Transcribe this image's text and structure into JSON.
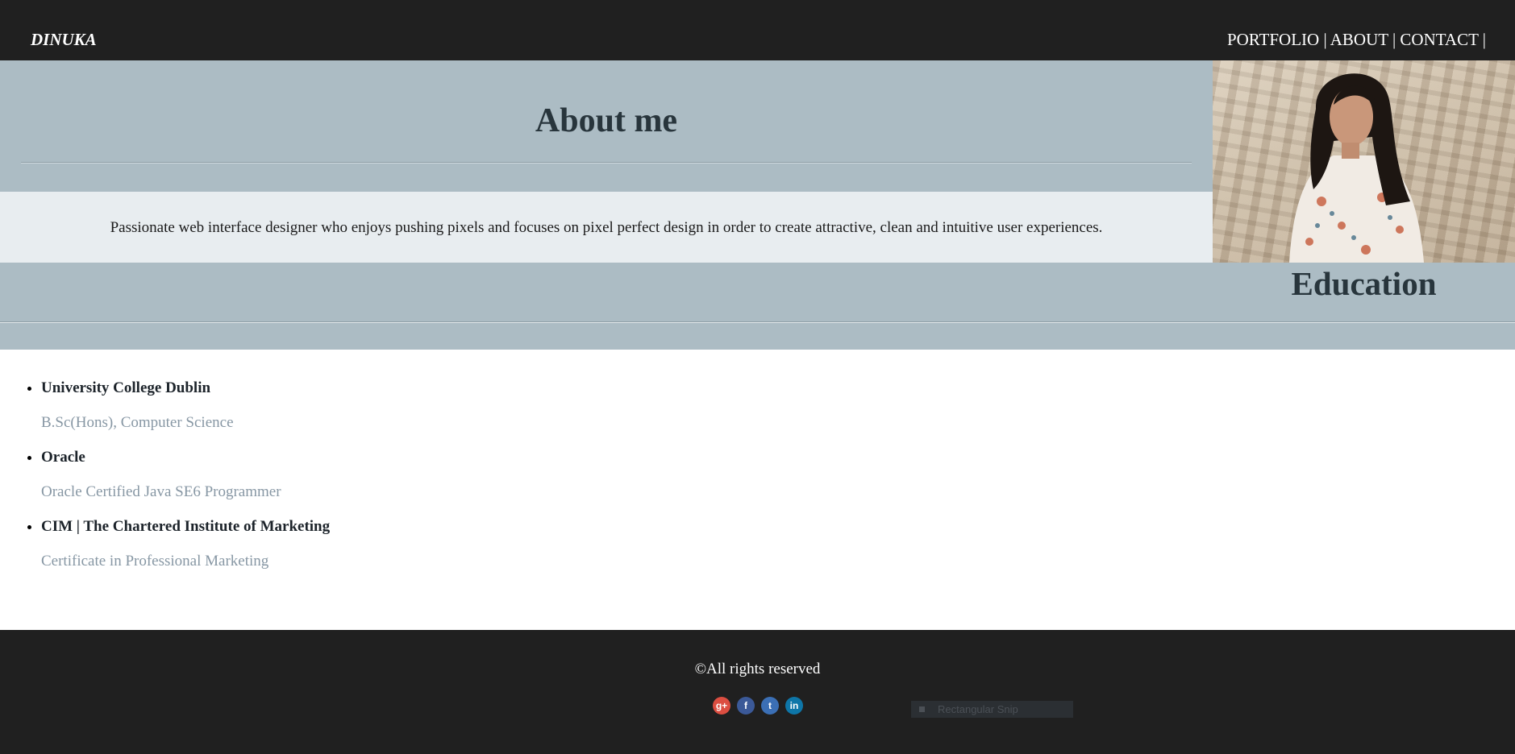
{
  "header": {
    "brand": "DINUKA",
    "nav": [
      {
        "label": "PORTFOLIO"
      },
      {
        "label": "ABOUT"
      },
      {
        "label": "CONTACT"
      }
    ],
    "separator": "|"
  },
  "about": {
    "title": "About me",
    "text": "Passionate web interface designer who enjoys pushing pixels and focuses on pixel perfect design in order to create attractive, clean and intuitive user experiences."
  },
  "education": {
    "title": "Education",
    "items": [
      {
        "institution": "University College Dublin",
        "qualification": "B.Sc(Hons), Computer Science"
      },
      {
        "institution": "Oracle",
        "qualification": "Oracle Certified Java SE6 Programmer"
      },
      {
        "institution": "CIM | The Chartered Institute of Marketing",
        "qualification": "Certificate in Professional Marketing"
      }
    ]
  },
  "footer": {
    "copyright": "©All rights reserved",
    "socials": [
      {
        "icon": "google-plus-icon",
        "glyph": "g+",
        "color": "#dc4e41"
      },
      {
        "icon": "facebook-icon",
        "glyph": "f",
        "color": "#3b5998"
      },
      {
        "icon": "twitter-icon",
        "glyph": "t",
        "color": "#3b6fb5"
      },
      {
        "icon": "linkedin-icon",
        "glyph": "in",
        "color": "#0e76a8"
      }
    ],
    "snip_label": "Rectangular Snip"
  }
}
